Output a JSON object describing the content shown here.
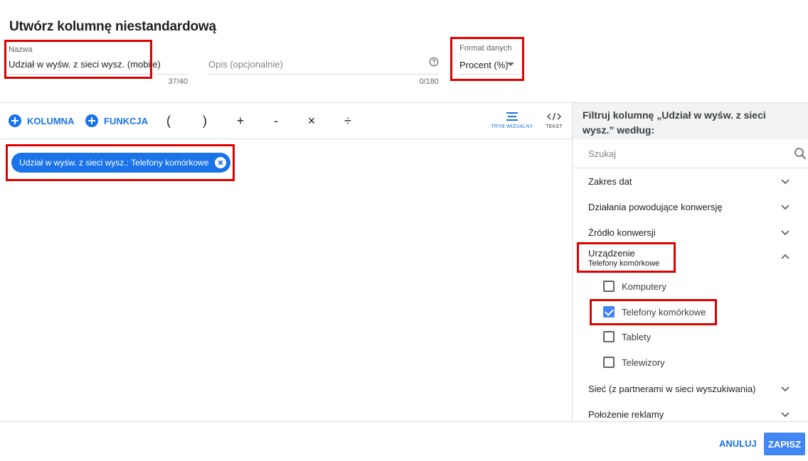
{
  "dialog": {
    "title": "Utwórz kolumnę niestandardową"
  },
  "name_field": {
    "label": "Nazwa",
    "value": "Udział w wyśw. z sieci wysz. (mobile)",
    "counter": "37/40"
  },
  "description_field": {
    "placeholder": "Opis (opcjonalnie)",
    "counter": "0/180",
    "help_icon": "help-circle-icon"
  },
  "format_field": {
    "label": "Format danych",
    "value": "Procent (%)"
  },
  "toolbar": {
    "column_label": "KOLUMNA",
    "function_label": "FUNKCJA",
    "operators": [
      "(",
      ")",
      "+",
      "-",
      "×",
      "÷"
    ],
    "visual_mode_label": "TRYB WIZUALNY",
    "text_mode_label": "TEKST"
  },
  "formula": {
    "chip_label": "Udział w wyśw. z sieci wysz.: Telefony komórkowe"
  },
  "filter_panel": {
    "header": "Filtruj kolumnę „Udział w wyśw. z sieci wysz.” według:",
    "search_placeholder": "Szukaj",
    "sections": [
      {
        "label": "Zakres dat"
      },
      {
        "label": "Działania powodujące konwersję"
      },
      {
        "label": "Źródło konwersji"
      },
      {
        "label": "Urządzenie",
        "sublabel": "Telefony komórkowe",
        "expanded": true
      },
      {
        "label": "Sieć (z partnerami w sieci wyszukiwania)"
      },
      {
        "label": "Położenie reklamy"
      }
    ],
    "device_options": [
      {
        "label": "Komputery",
        "checked": false
      },
      {
        "label": "Telefony komórkowe",
        "checked": true
      },
      {
        "label": "Tablety",
        "checked": false
      },
      {
        "label": "Telewizory",
        "checked": false
      }
    ]
  },
  "footer": {
    "cancel_label": "ANULUJ",
    "save_label": "ZAPISZ"
  },
  "colors": {
    "accent": "#1a73e8",
    "primary_button": "#4285f4",
    "highlight": "#e00000"
  }
}
